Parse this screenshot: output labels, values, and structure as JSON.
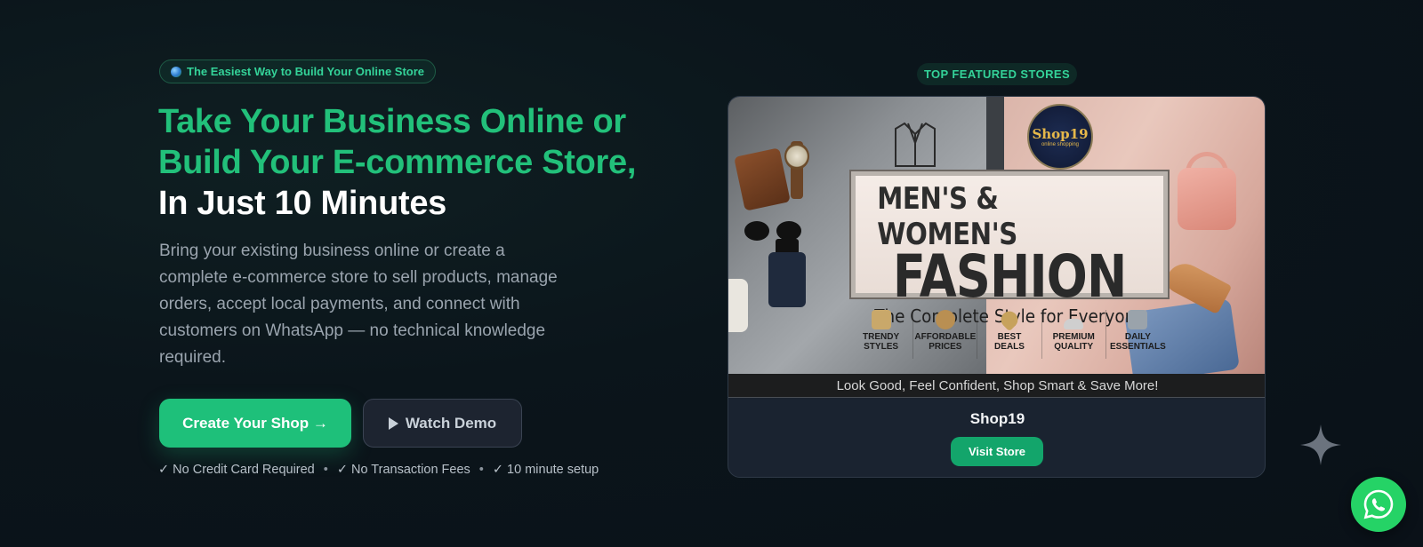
{
  "hero": {
    "badge_text": "The Easiest Way to Build Your Online Store",
    "headline_line1": "Take Your Business Online or",
    "headline_line2": "Build Your E-commerce Store,",
    "headline_line3": "In Just 10 Minutes",
    "lead": "Bring your existing business online or create a complete e-commerce store to sell products, manage orders, accept local payments, and connect with customers on WhatsApp — no technical knowledge required.",
    "primary_button": "Create Your Shop →",
    "secondary_button": "Watch Demo",
    "checks": [
      "✓ No Credit Card Required",
      "✓ No Transaction Fees",
      "✓ 10 minute setup"
    ],
    "separator": "•"
  },
  "featured": {
    "label": "TOP FEATURED STORES",
    "store": {
      "name": "Shop19",
      "visit_label": "Visit Store",
      "banner": {
        "logo_name": "Shop19",
        "logo_sub": "online shopping",
        "title_line1": "MEN'S & WOMEN'S",
        "title_line2": "FASHION",
        "title_line3": "The Complete Style for Everyone",
        "features": [
          {
            "line1": "TRENDY",
            "line2": "STYLES",
            "color": "#c9a86a"
          },
          {
            "line1": "AFFORDABLE",
            "line2": "PRICES",
            "color": "#b98f52"
          },
          {
            "line1": "BEST",
            "line2": "DEALS",
            "color": "#c7a25c"
          },
          {
            "line1": "PREMIUM",
            "line2": "QUALITY",
            "color": "#cfcfcf"
          },
          {
            "line1": "DAILY",
            "line2": "ESSENTIALS",
            "color": "#9aa3ab"
          }
        ],
        "tagline": "Look Good, Feel Confident, Shop Smart & Save More!"
      }
    }
  },
  "colors": {
    "accent": "#22c07a",
    "button_primary": "#1ec07a",
    "visit_button": "#13a56b",
    "whatsapp": "#25d366"
  },
  "icons": [
    "globe-icon",
    "play-icon",
    "sparkle-icon",
    "whatsapp-icon"
  ]
}
